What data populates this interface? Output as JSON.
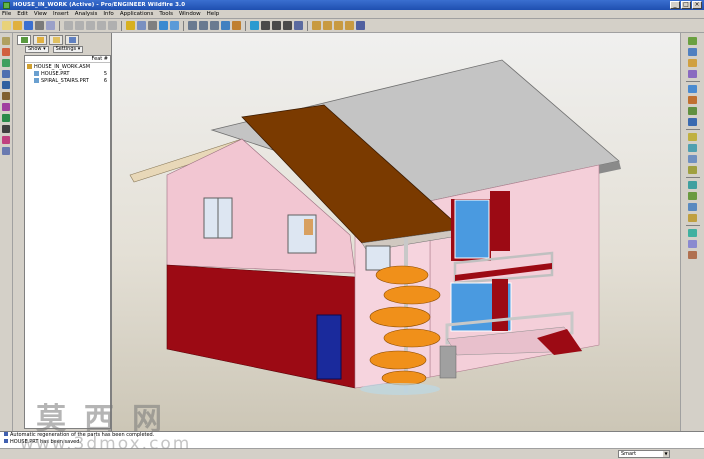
{
  "app": {
    "title": "HOUSE_IN_WORK (Active) - Pro/ENGINEER Wildfire 3.0",
    "window_buttons": [
      "_",
      "□",
      "×"
    ]
  },
  "menu": [
    "File",
    "Edit",
    "View",
    "Insert",
    "Analysis",
    "Info",
    "Applications",
    "Tools",
    "Window",
    "Help"
  ],
  "toolbar": {
    "icons": [
      {
        "name": "new-file-icon",
        "color": "#e8d27a"
      },
      {
        "name": "open-file-icon",
        "color": "#e0b040"
      },
      {
        "name": "save-icon",
        "color": "#3a6fd0"
      },
      {
        "name": "print-icon",
        "color": "#7a7a7a"
      },
      {
        "name": "email-icon",
        "color": "#9aa0c8"
      },
      {
        "name": "undo-icon",
        "color": "#b0b0b0"
      },
      {
        "name": "redo-icon",
        "color": "#b0b0b0"
      },
      {
        "name": "cut-icon",
        "color": "#b0b0b0"
      },
      {
        "name": "copy-icon",
        "color": "#b0b0b0"
      },
      {
        "name": "paste-icon",
        "color": "#b0b0b0"
      },
      {
        "name": "regenerate-icon",
        "color": "#d7b020"
      },
      {
        "name": "find-icon",
        "color": "#7a90c0"
      },
      {
        "name": "select-icon",
        "color": "#808080"
      },
      {
        "name": "repaint-icon",
        "color": "#3a8ad0"
      },
      {
        "name": "orient-icon",
        "color": "#5a9ad8"
      },
      {
        "name": "zoom-in-icon",
        "color": "#6a7a90"
      },
      {
        "name": "zoom-out-icon",
        "color": "#6a7a90"
      },
      {
        "name": "refit-icon",
        "color": "#6a7a90"
      },
      {
        "name": "saved-views-icon",
        "color": "#4080c0"
      },
      {
        "name": "layers-icon",
        "color": "#c08030"
      },
      {
        "name": "appearance-icon",
        "color": "#2a9ad0"
      },
      {
        "name": "wireframe-icon",
        "color": "#4a4a4a"
      },
      {
        "name": "hidden-line-icon",
        "color": "#4a4a4a"
      },
      {
        "name": "no-hidden-icon",
        "color": "#4a4a4a"
      },
      {
        "name": "shading-icon",
        "color": "#5a6aa0"
      },
      {
        "name": "datum-planes-icon",
        "color": "#c89a40"
      },
      {
        "name": "datum-axes-icon",
        "color": "#c89a40"
      },
      {
        "name": "datum-points-icon",
        "color": "#c89a40"
      },
      {
        "name": "coordinate-systems-icon",
        "color": "#c89a40"
      },
      {
        "name": "context-help-icon",
        "color": "#5060a0"
      }
    ]
  },
  "left_tools": [
    {
      "name": "datum-plane-tool-icon",
      "color": "#b0a060"
    },
    {
      "name": "axis-tool-icon",
      "color": "#d06040"
    },
    {
      "name": "point-tool-icon",
      "color": "#40a060"
    },
    {
      "name": "coordinate-tool-icon",
      "color": "#5070b0"
    },
    {
      "name": "csys-tool-icon",
      "color": "#3060a0"
    },
    {
      "name": "sketch-tool-icon",
      "color": "#806030"
    },
    {
      "name": "curve-tool-icon",
      "color": "#a040a0"
    },
    {
      "name": "globe-tool-icon",
      "color": "#2a8a4a"
    },
    {
      "name": "mirror-tool-icon",
      "color": "#404040"
    },
    {
      "name": "analysis-tool-icon",
      "color": "#c04080"
    },
    {
      "name": "annotation-tool-icon",
      "color": "#6a7ab0"
    }
  ],
  "navigator": {
    "tabs": [
      "model-tree-tab",
      "folder-browser-tab",
      "favorites-tab",
      "connections-tab"
    ],
    "show_label": "Show ▾",
    "settings_label": "Settings ▾",
    "column_header": "Feat #",
    "tree": [
      {
        "label": "HOUSE_IN_WORK.ASM",
        "feat": "",
        "level": 0
      },
      {
        "label": "HOUSE.PRT",
        "feat": "5",
        "level": 1
      },
      {
        "label": "SPIRAL_STAIRS.PRT",
        "feat": "6",
        "level": 1
      }
    ]
  },
  "right_tools": [
    {
      "name": "extrude-tool-icon",
      "color": "#6aa040"
    },
    {
      "name": "revolve-tool-icon",
      "color": "#5080c0"
    },
    {
      "name": "sweep-tool-icon",
      "color": "#d0a040"
    },
    {
      "name": "blend-tool-icon",
      "color": "#8a6ac0"
    },
    {
      "name": "hole-tool-icon",
      "color": "#4a8ad0"
    },
    {
      "name": "shell-tool-icon",
      "color": "#c07030"
    },
    {
      "name": "rib-tool-icon",
      "color": "#609040"
    },
    {
      "name": "draft-tool-icon",
      "color": "#3a6ab0"
    },
    {
      "name": "round-tool-icon",
      "color": "#c0b040"
    },
    {
      "name": "chamfer-tool-icon",
      "color": "#50a0b0"
    },
    {
      "name": "pattern-tool-icon",
      "color": "#7090c0"
    },
    {
      "name": "merge-tool-icon",
      "color": "#a0a040"
    },
    {
      "name": "trim-tool-icon",
      "color": "#40a0a0"
    },
    {
      "name": "component-tool-icon",
      "color": "#6a9a40"
    },
    {
      "name": "assemble-tool-icon",
      "color": "#5a8ac0"
    },
    {
      "name": "package-tool-icon",
      "color": "#c0a040"
    },
    {
      "name": "mechanism-tool-icon",
      "color": "#40b0a0"
    },
    {
      "name": "explode-tool-icon",
      "color": "#8a8ad0"
    },
    {
      "name": "view-manager-icon",
      "color": "#b07050"
    }
  ],
  "messages": [
    "Automatic regeneration of the parts has been completed.",
    "HOUSE.PRT has been saved."
  ],
  "status": {
    "filter": "Smart"
  },
  "model": {
    "colors": {
      "wall_pink": "#f2c6d2",
      "wall_dark_pink": "#d99aae",
      "base_red": "#9c0a14",
      "roof_gray": "#b8b8b8",
      "roof_brown": "#7a3a00",
      "door_blue": "#1a2a9c",
      "window_blue": "#4a9ae0",
      "stairs_orange": "#f0901a"
    }
  },
  "watermark": {
    "chars": "莫西网",
    "url": "www.3dmox.com"
  }
}
